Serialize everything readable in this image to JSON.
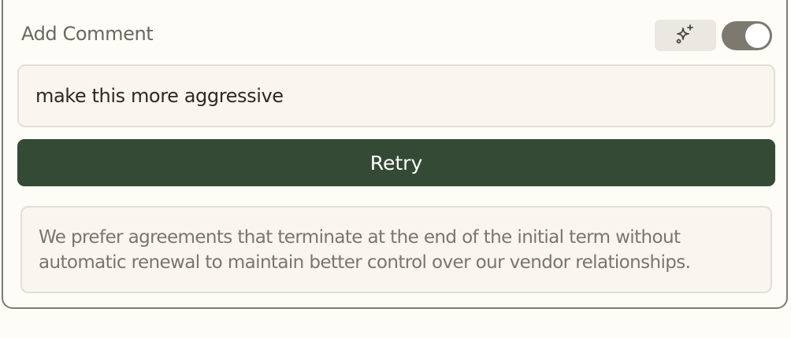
{
  "comment_panel": {
    "title": "Add Comment",
    "ai_button_icon": "sparkles-icon",
    "toggle_on": true,
    "input_value": "make this more aggressive",
    "retry_label": "Retry",
    "suggestion_text": "We prefer agreements that terminate at the end of the initial term without automatic renewal to maintain better control over our vendor relationships."
  },
  "colors": {
    "accent": "#344a35",
    "toggle_track": "#7e796e",
    "panel_border": "#7f7b70"
  }
}
